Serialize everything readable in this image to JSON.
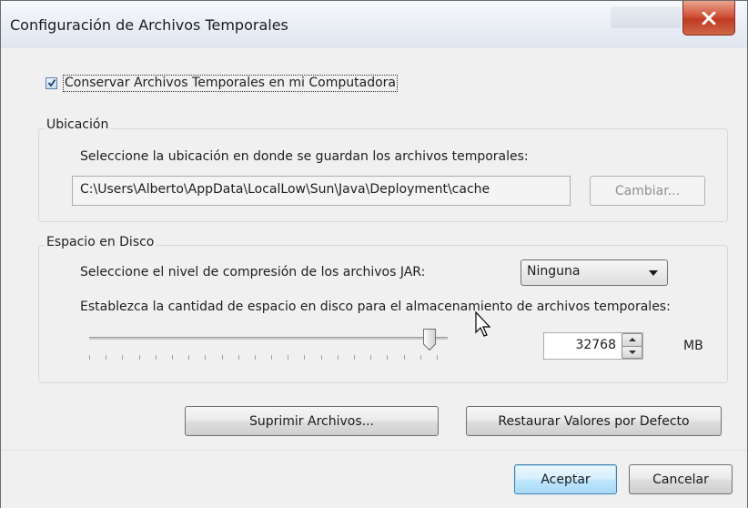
{
  "window": {
    "title": "Configuración de Archivos Temporales",
    "close_label": "X"
  },
  "keep_files": {
    "label": "Conservar Archivos Temporales en mi Computadora",
    "checked": true
  },
  "location": {
    "legend": "Ubicación",
    "prompt": "Seleccione la ubicación en donde se guardan los archivos temporales:",
    "path": "C:\\Users\\Alberto\\AppData\\LocalLow\\Sun\\Java\\Deployment\\cache",
    "change_label": "Cambiar..."
  },
  "disk": {
    "legend": "Espacio en Disco",
    "compression_prompt": "Seleccione el nivel de compresión de los archivos JAR:",
    "compression_value": "Ninguna",
    "space_prompt": "Establezca la cantidad de espacio en disco para el almacenamiento de archivos temporales:",
    "space_value": "32768",
    "space_unit": "MB",
    "slider_fraction": 0.95
  },
  "actions": {
    "delete_label": "Suprimir Archivos...",
    "restore_label": "Restaurar Valores por Defecto"
  },
  "footer": {
    "ok_label": "Aceptar",
    "cancel_label": "Cancelar"
  },
  "colors": {
    "close_button": "#c8452c",
    "default_button_border": "#3c7fb1",
    "dialog_bg": "#f0f0f0"
  }
}
